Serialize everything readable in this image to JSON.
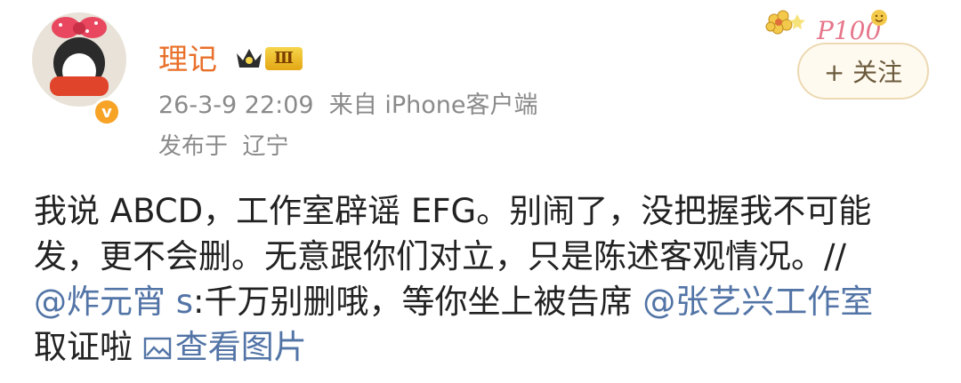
{
  "user": {
    "name": "理记",
    "vip_level": "Ⅲ",
    "verified_mark": "v"
  },
  "meta": {
    "time_source": "26-3-9 22:09  来自 iPhone客户端",
    "location": "发布于  辽宁"
  },
  "follow_button": {
    "label": "+ 关注"
  },
  "decor_text": "P100",
  "post": {
    "line1": "我说 ABCD，工作室辟谣 EFG。别闹了，没把握我不可能",
    "line2": "发，更不会删。无意跟你们对立，只是陈述客观情况。//",
    "mention1": "@炸元宵 s",
    "line3_mid": ":千万别删哦，等你坐上被告席 ",
    "mention2": "@张艺兴工作室",
    "line4_start": "取证啦 ",
    "view_pics": "查看图片"
  },
  "colors": {
    "username": "#e8702a",
    "link": "#5274a6",
    "meta": "#8a8a8a",
    "vip_gold": "#e3a715"
  },
  "icons": [
    "crown-icon",
    "verified-icon",
    "image-icon",
    "flower-decor-icon"
  ]
}
